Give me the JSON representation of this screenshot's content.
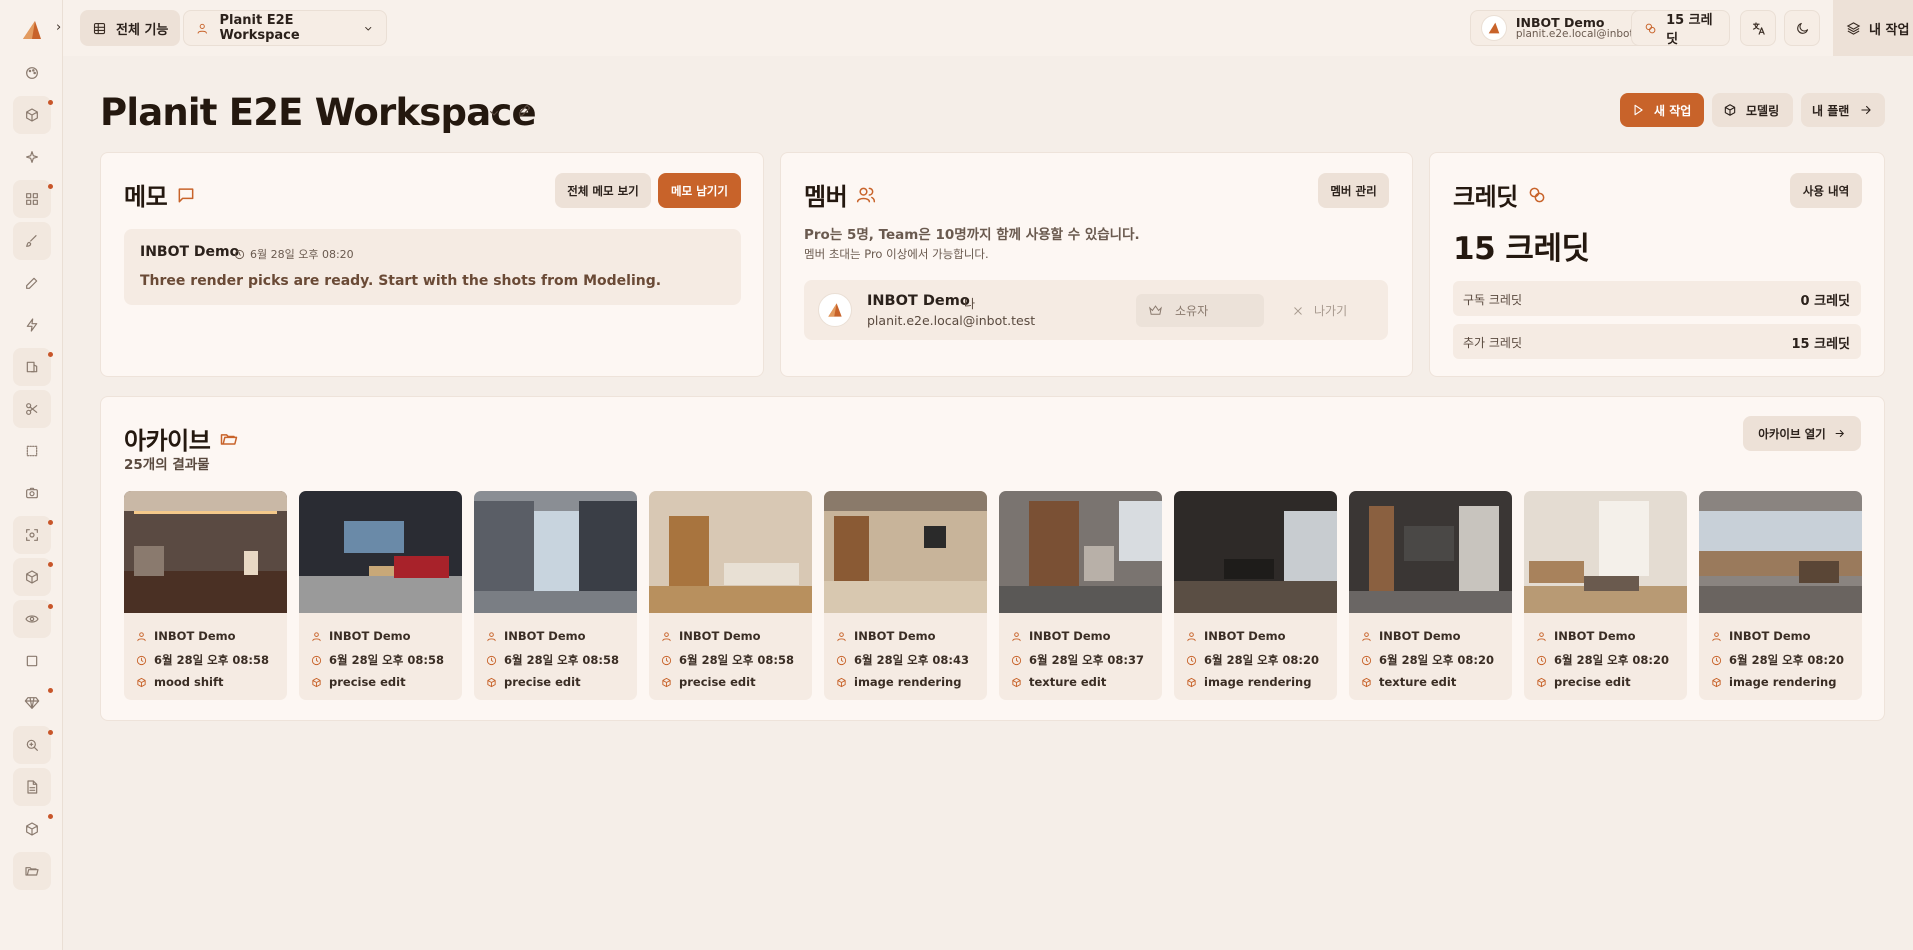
{
  "topbar": {
    "all_features": "전체 기능",
    "workspace": "Planit E2E Workspace",
    "user_name": "INBOT Demo",
    "user_email": "planit.e2e.local@inbot.test",
    "credits": "15 크레딧",
    "new_task": "내 작업"
  },
  "header": {
    "title": "Planit E2E Workspace",
    "new_task": "새 작업",
    "modeling": "모델링",
    "my_plan": "내 플랜"
  },
  "memo": {
    "title": "메모",
    "view_all": "전체 메모 보기",
    "leave_memo": "메모 남기기",
    "author": "INBOT Demo",
    "time": "6월 28일 오후 08:20",
    "text": "Three render picks are ready. Start with the shots from Modeling."
  },
  "members": {
    "title": "멤버",
    "manage": "멤버 관리",
    "desc1": "Pro는 5명, Team은 10명까지 함께 사용할 수 있습니다.",
    "desc2": "멤버 초대는 Pro 이상에서 가능합니다.",
    "member_name": "INBOT Demo",
    "me_label": "나",
    "member_email": "planit.e2e.local@inbot.test",
    "role": "소유자",
    "leave": "나가기"
  },
  "credits": {
    "title": "크레딧",
    "history": "사용 내역",
    "total": "15 크레딧",
    "subscription_label": "구독 크레딧",
    "subscription_value": "0 크레딧",
    "extra_label": "추가 크레딧",
    "extra_value": "15 크레딧"
  },
  "archive": {
    "title": "아카이브",
    "count": "25개의 결과물",
    "open": "아카이브 열기",
    "items": [
      {
        "author": "INBOT Demo",
        "time": "6월 28일 오후 08:58",
        "type": "mood shift"
      },
      {
        "author": "INBOT Demo",
        "time": "6월 28일 오후 08:58",
        "type": "precise edit"
      },
      {
        "author": "INBOT Demo",
        "time": "6월 28일 오후 08:58",
        "type": "precise edit"
      },
      {
        "author": "INBOT Demo",
        "time": "6월 28일 오후 08:58",
        "type": "precise edit"
      },
      {
        "author": "INBOT Demo",
        "time": "6월 28일 오후 08:43",
        "type": "image rendering"
      },
      {
        "author": "INBOT Demo",
        "time": "6월 28일 오후 08:37",
        "type": "texture edit"
      },
      {
        "author": "INBOT Demo",
        "time": "6월 28일 오후 08:20",
        "type": "image rendering"
      },
      {
        "author": "INBOT Demo",
        "time": "6월 28일 오후 08:20",
        "type": "texture edit"
      },
      {
        "author": "INBOT Demo",
        "time": "6월 28일 오후 08:20",
        "type": "precise edit"
      },
      {
        "author": "INBOT Demo",
        "time": "6월 28일 오후 08:20",
        "type": "image rendering"
      }
    ]
  },
  "colors": {
    "accent": "#c8632a",
    "background": "#f5eee8",
    "card": "#fdf7f3"
  },
  "rail_icons": [
    "palette-icon",
    "cube-icon",
    "sparkle-icon",
    "grid-icon",
    "brush-icon",
    "pencil-icon",
    "bolt-icon",
    "layers-icon",
    "scissors-icon",
    "select-icon",
    "camera-icon",
    "focus-icon",
    "box-icon",
    "eye-icon",
    "square-icon",
    "gem-icon",
    "zoom-icon",
    "document-icon",
    "package-icon",
    "folder-icon"
  ]
}
